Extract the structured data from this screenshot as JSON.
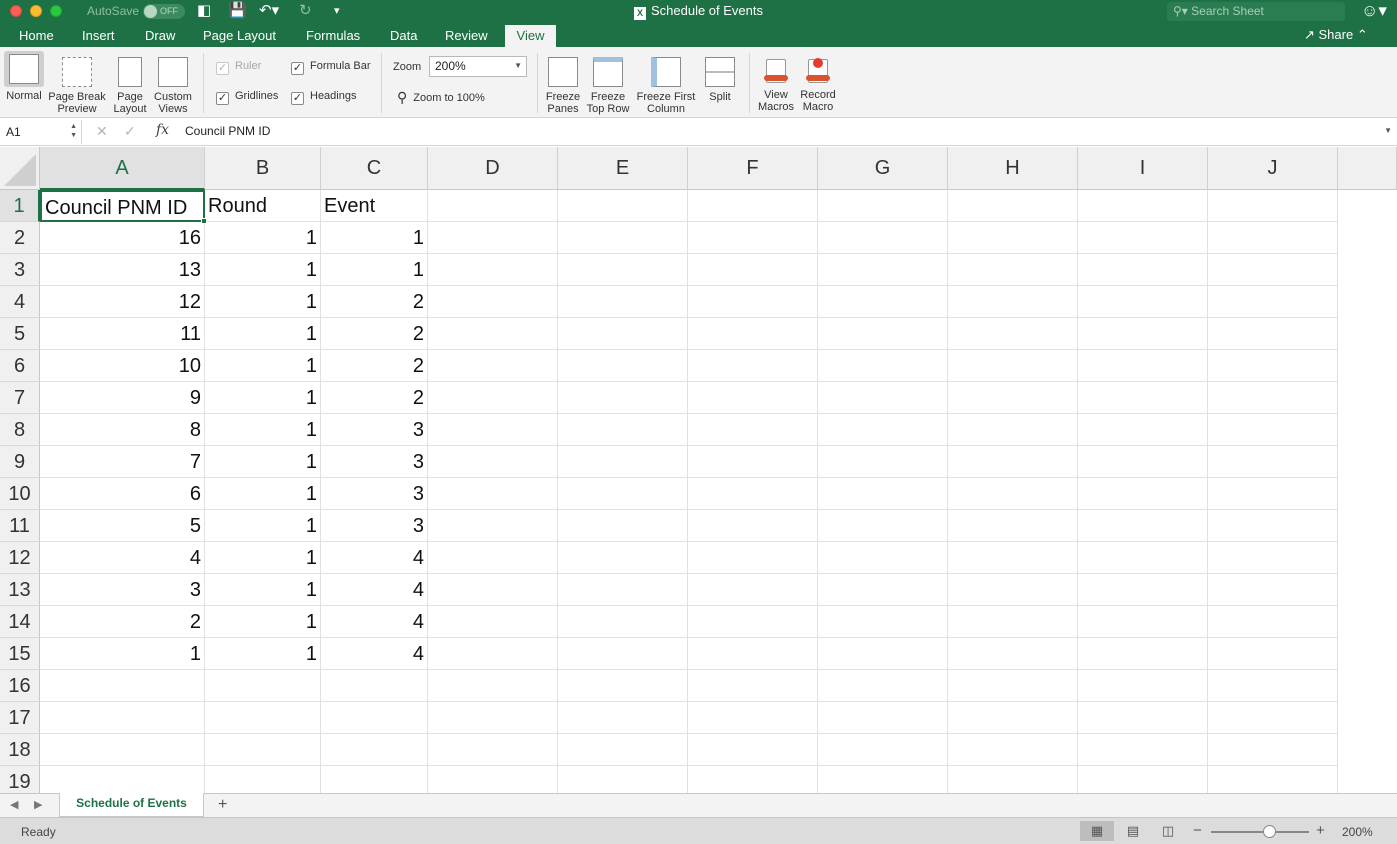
{
  "titlebar": {
    "autosave_label": "AutoSave",
    "autosave_state": "OFF",
    "doc_title": "Schedule of Events",
    "search_placeholder": "Search Sheet"
  },
  "tabs": [
    "Home",
    "Insert",
    "Draw",
    "Page Layout",
    "Formulas",
    "Data",
    "Review",
    "View"
  ],
  "active_tab": "View",
  "share_label": "Share",
  "ribbon": {
    "workbook_views": [
      {
        "line1": "Normal",
        "line2": ""
      },
      {
        "line1": "Page Break",
        "line2": "Preview"
      },
      {
        "line1": "Page",
        "line2": "Layout"
      },
      {
        "line1": "Custom",
        "line2": "Views"
      }
    ],
    "show": {
      "ruler": {
        "label": "Ruler",
        "checked": true,
        "enabled": false
      },
      "formula_bar": {
        "label": "Formula Bar",
        "checked": true,
        "enabled": true
      },
      "gridlines": {
        "label": "Gridlines",
        "checked": true,
        "enabled": true
      },
      "headings": {
        "label": "Headings",
        "checked": true,
        "enabled": true
      }
    },
    "zoom_label": "Zoom",
    "zoom_value": "200%",
    "zoom_to_100": "Zoom to 100%",
    "window": [
      {
        "line1": "Freeze",
        "line2": "Panes"
      },
      {
        "line1": "Freeze",
        "line2": "Top Row"
      },
      {
        "line1": "Freeze First",
        "line2": "Column"
      },
      {
        "line1": "Split",
        "line2": ""
      }
    ],
    "macros": [
      {
        "line1": "View",
        "line2": "Macros"
      },
      {
        "line1": "Record",
        "line2": "Macro"
      }
    ]
  },
  "formula_bar": {
    "name_box": "A1",
    "fx_label": "fx",
    "content": "Council PNM ID"
  },
  "sheet": {
    "columns": [
      "A",
      "B",
      "C",
      "D",
      "E",
      "F",
      "G",
      "H",
      "I",
      "J"
    ],
    "active_column": "A",
    "active_row": 1,
    "row_numbers": [
      "1",
      "2",
      "3",
      "4",
      "5",
      "6",
      "7",
      "8",
      "9",
      "10",
      "11",
      "12",
      "13",
      "14",
      "15",
      "16",
      "17",
      "18",
      "19"
    ],
    "header_row": [
      "Council PNM ID",
      "Round",
      "Event"
    ],
    "rows": [
      [
        "16",
        "1",
        "1"
      ],
      [
        "13",
        "1",
        "1"
      ],
      [
        "12",
        "1",
        "2"
      ],
      [
        "11",
        "1",
        "2"
      ],
      [
        "10",
        "1",
        "2"
      ],
      [
        "9",
        "1",
        "2"
      ],
      [
        "8",
        "1",
        "3"
      ],
      [
        "7",
        "1",
        "3"
      ],
      [
        "6",
        "1",
        "3"
      ],
      [
        "5",
        "1",
        "3"
      ],
      [
        "4",
        "1",
        "4"
      ],
      [
        "3",
        "1",
        "4"
      ],
      [
        "2",
        "1",
        "4"
      ],
      [
        "1",
        "1",
        "4"
      ]
    ]
  },
  "sheet_tabs": {
    "active": "Schedule of Events",
    "add_label": "+"
  },
  "status": {
    "text": "Ready",
    "zoom_percent": "200%",
    "zoom_level": 0.6
  },
  "colors": {
    "brand": "#1e7145",
    "ribbon_bg": "#f3f3f3",
    "grid_line": "#e1e1e1"
  }
}
